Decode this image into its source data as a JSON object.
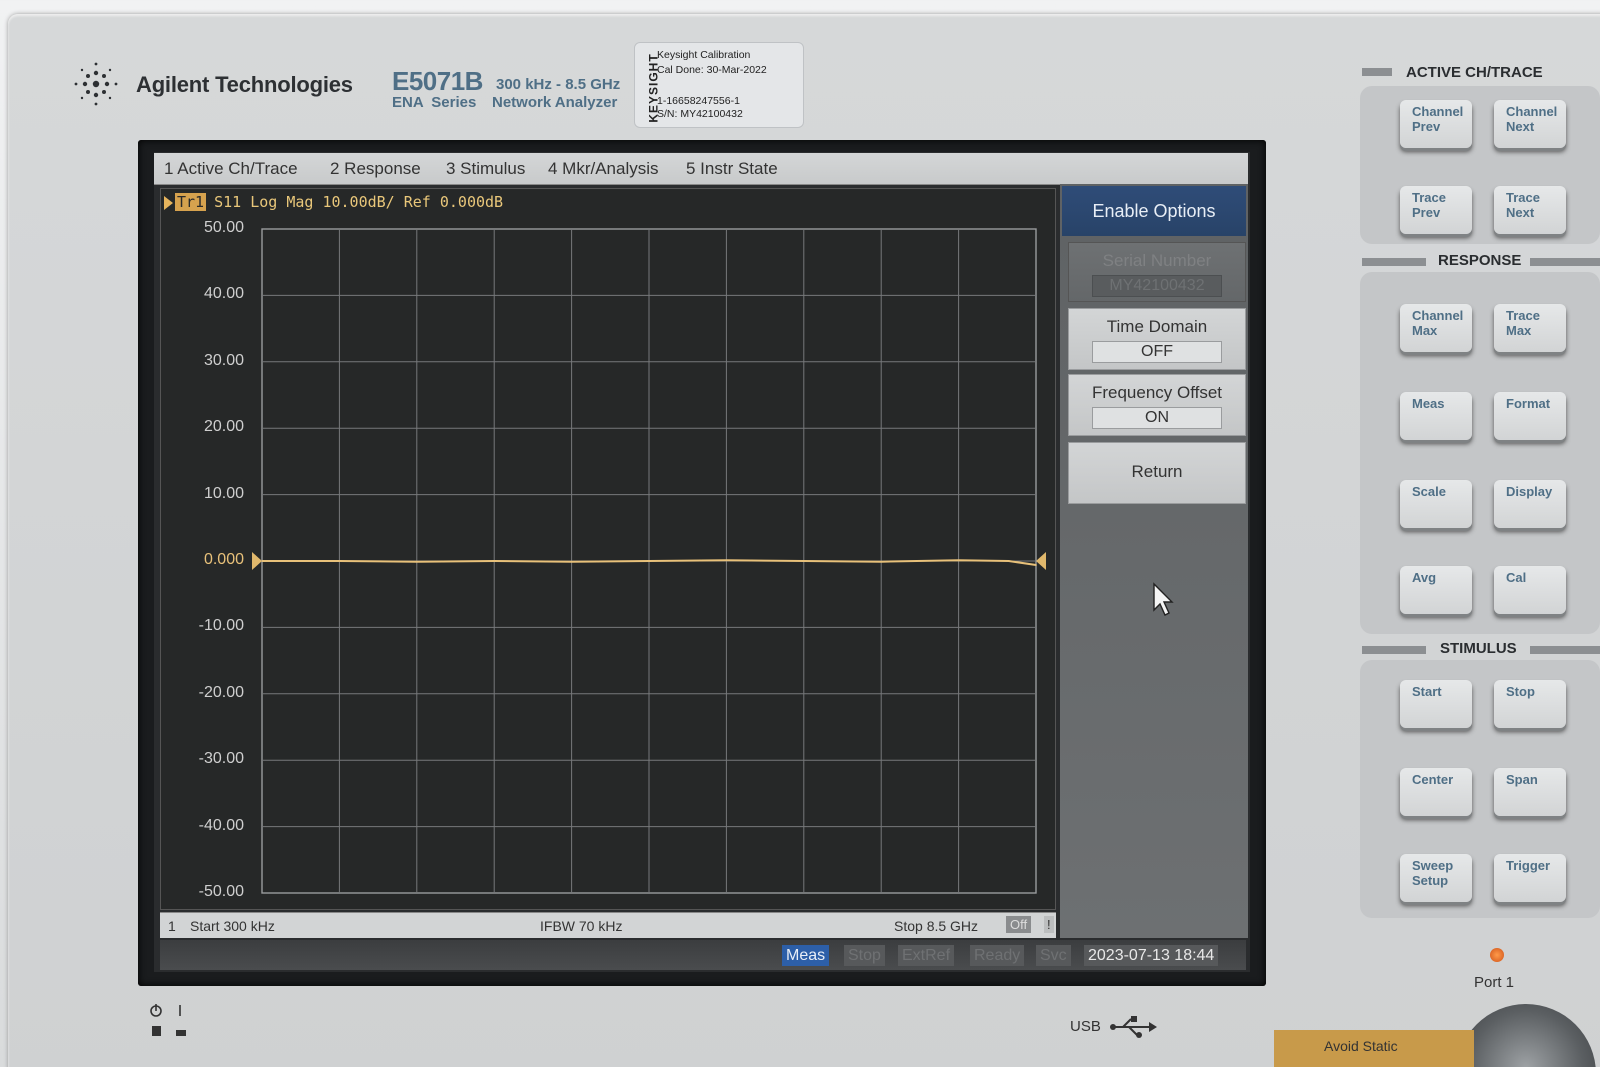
{
  "instrument": {
    "brand": "Agilent Technologies",
    "model": "E5071B",
    "series": "ENA Series",
    "frequency_range": "300 kHz - 8.5 GHz",
    "description": "Network Analyzer"
  },
  "cal_sticker": {
    "vendor": "KEYSIGHT",
    "line1": "Keysight Calibration",
    "line2": "Cal Done:   30-Mar-2022",
    "line3": "1-16658247556-1",
    "line4": "S/N: MY42100432"
  },
  "menu": [
    {
      "label": "1 Active Ch/Trace"
    },
    {
      "label": "2 Response"
    },
    {
      "label": "3 Stimulus"
    },
    {
      "label": "4 Mkr/Analysis"
    },
    {
      "label": "5 Instr State"
    }
  ],
  "trace_header": {
    "trace_id": "Tr1",
    "text": "S11  Log Mag 10.00dB/ Ref 0.000dB"
  },
  "chart_data": {
    "type": "line",
    "title": "",
    "xlabel": "",
    "ylabel": "",
    "ylim": [
      -50,
      50
    ],
    "y_ticks": [
      "50.00",
      "40.00",
      "30.00",
      "20.00",
      "10.00",
      "0.000",
      "-10.00",
      "-20.00",
      "-30.00",
      "-40.00",
      "-50.00"
    ],
    "x_divisions": 10,
    "grid": true,
    "reference_value": 0,
    "series": [
      {
        "color": "#e8c17a",
        "x": [
          0.0003,
          0.85,
          1.7,
          2.55,
          3.4,
          4.25,
          5.1,
          5.95,
          6.8,
          7.65,
          8.2,
          8.5
        ],
        "y": [
          0.0,
          0.0,
          -0.1,
          0.0,
          -0.1,
          0.0,
          0.1,
          0.0,
          -0.1,
          0.1,
          0.0,
          -0.6
        ]
      }
    ],
    "x_range_ghz": [
      0.0003,
      8.5
    ]
  },
  "footer": {
    "channel": "1",
    "start": "Start 300 kHz",
    "ifbw": "IFBW 70 kHz",
    "stop": "Stop 8.5 GHz",
    "off": "Off",
    "excl": "!"
  },
  "status": {
    "meas": "Meas",
    "stop": "Stop",
    "extref": "ExtRef",
    "ready": "Ready",
    "svc": "Svc",
    "datetime": "2023-07-13 18:44"
  },
  "softkeys": {
    "enable_options": "Enable Options",
    "serial_number_label": "Serial Number",
    "serial_number_value": "MY42100432",
    "time_domain_label": "Time Domain",
    "time_domain_value": "OFF",
    "freq_offset_label": "Frequency Offset",
    "freq_offset_value": "ON",
    "return": "Return"
  },
  "front_panel": {
    "active_title": "ACTIVE CH/TRACE",
    "response_title": "RESPONSE",
    "stimulus_title": "STIMULUS",
    "channel_prev": "Channel Prev",
    "channel_next": "Channel Next",
    "trace_prev": "Trace Prev",
    "trace_next": "Trace Next",
    "channel_max": "Channel Max",
    "trace_max": "Trace Max",
    "meas": "Meas",
    "format": "Format",
    "scale": "Scale",
    "display": "Display",
    "avg": "Avg",
    "cal": "Cal",
    "start": "Start",
    "stop": "Stop",
    "center": "Center",
    "span": "Span",
    "sweep_setup": "Sweep Setup",
    "trigger": "Trigger",
    "port": "Port 1",
    "usb": "USB",
    "avoid_static": "Avoid Static"
  }
}
